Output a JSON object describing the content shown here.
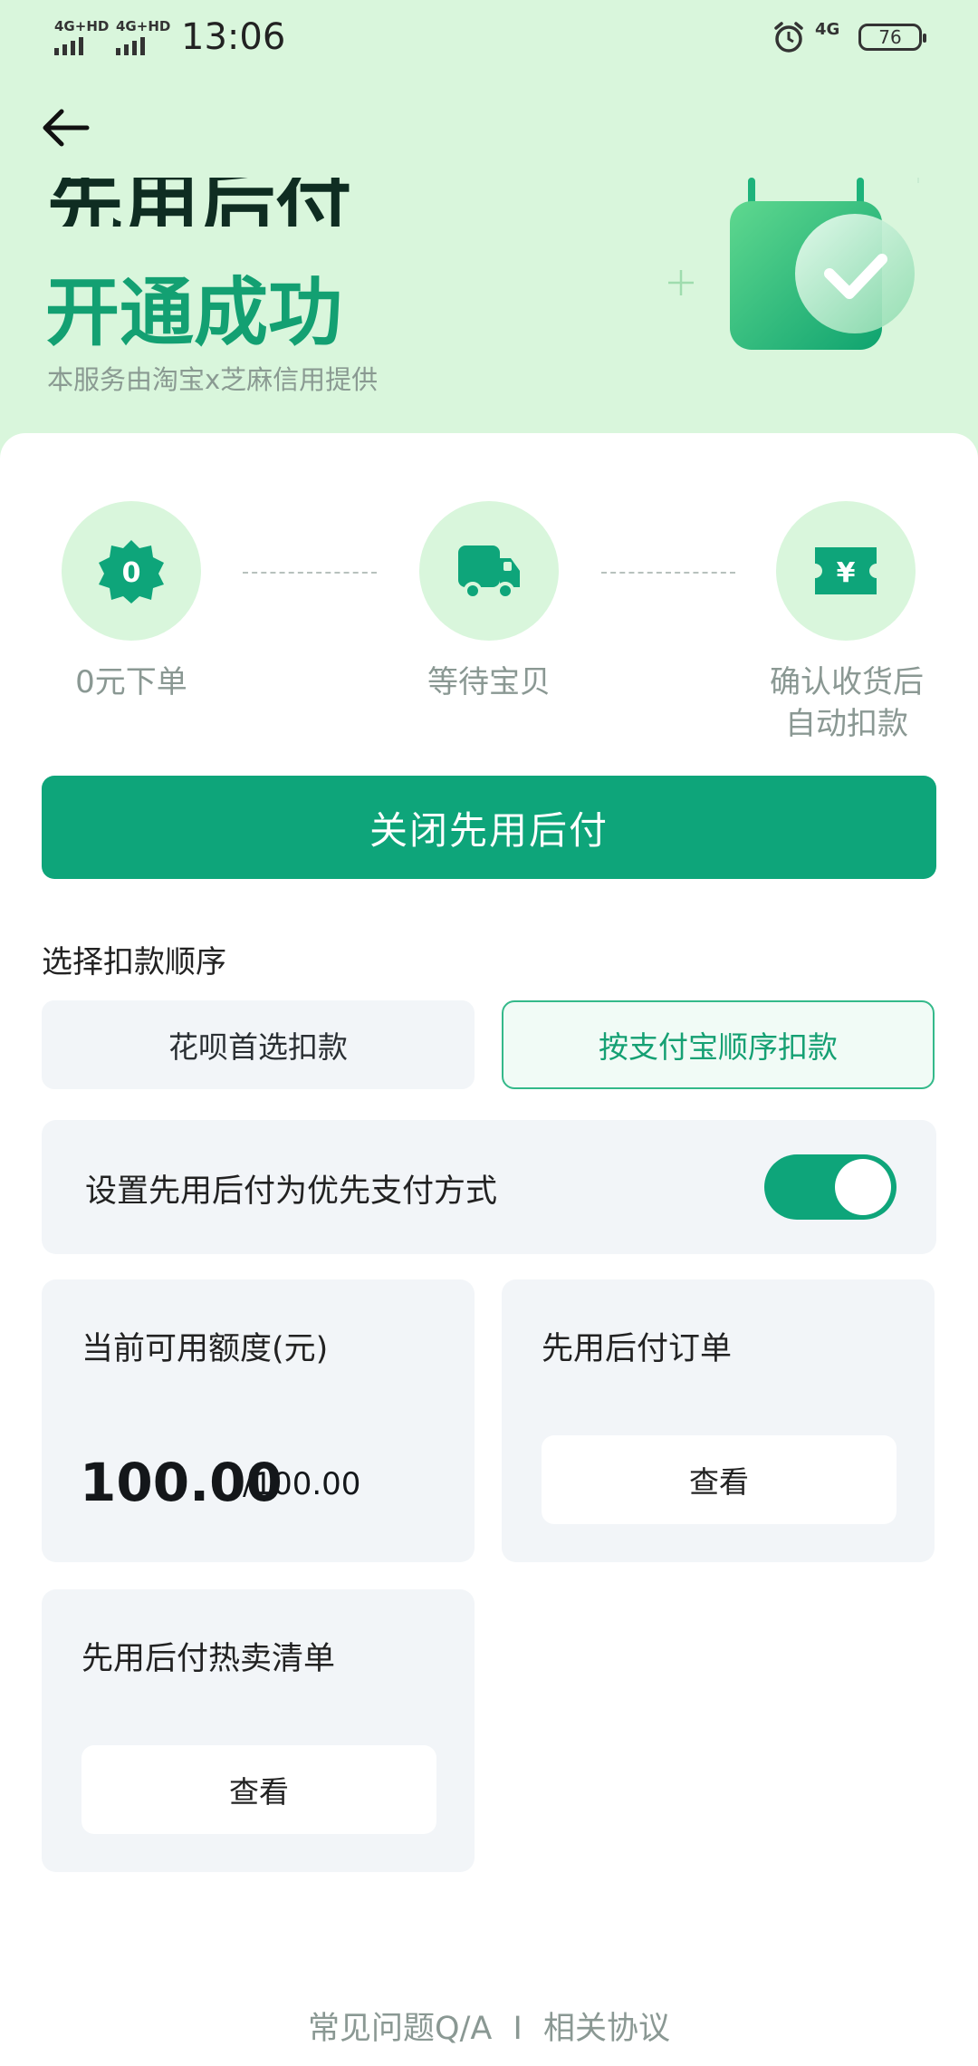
{
  "status_bar": {
    "signal_1": "4G+HD",
    "signal_2": "4G+HD",
    "time": "13:06",
    "net_type": "4G",
    "battery": "76",
    "icons": [
      "alarm-clock-icon",
      "battery-icon"
    ]
  },
  "header": {
    "back_icon": "arrow-left-icon",
    "title": "先用后付",
    "subtitle": "开通成功",
    "provider_note": "本服务由淘宝x芝麻信用提供",
    "illustration": "shopping-bag-check-icon"
  },
  "steps": [
    {
      "icon": "zero-badge-icon",
      "icon_text": "0",
      "label": "0元下单"
    },
    {
      "icon": "truck-icon",
      "label": "等待宝贝"
    },
    {
      "icon": "yuan-ticket-icon",
      "icon_text": "¥",
      "label_line1": "确认收货后",
      "label_line2": "自动扣款"
    }
  ],
  "close_button": "关闭先用后付",
  "deduction": {
    "title": "选择扣款顺序",
    "options": [
      "花呗首选扣款",
      "按支付宝顺序扣款"
    ],
    "selected": "按支付宝顺序扣款"
  },
  "priority_toggle": {
    "label": "设置先用后付为优先支付方式",
    "enabled": true
  },
  "credit": {
    "title": "当前可用额度(元)",
    "available": "100.00",
    "total": "/100.00"
  },
  "orders": {
    "title": "先用后付订单",
    "button": "查看"
  },
  "hot_list": {
    "title": "先用后付热卖清单",
    "button": "查看"
  },
  "footer": {
    "faq": "常见问题Q/A",
    "separator": "I",
    "agreements": "相关协议"
  },
  "colors": {
    "hero_bg": "#d9f6dc",
    "accent": "#0ea57a",
    "accent_text": "#13a072",
    "tile_bg": "#f2f5f8",
    "muted_text": "#8a9893"
  }
}
